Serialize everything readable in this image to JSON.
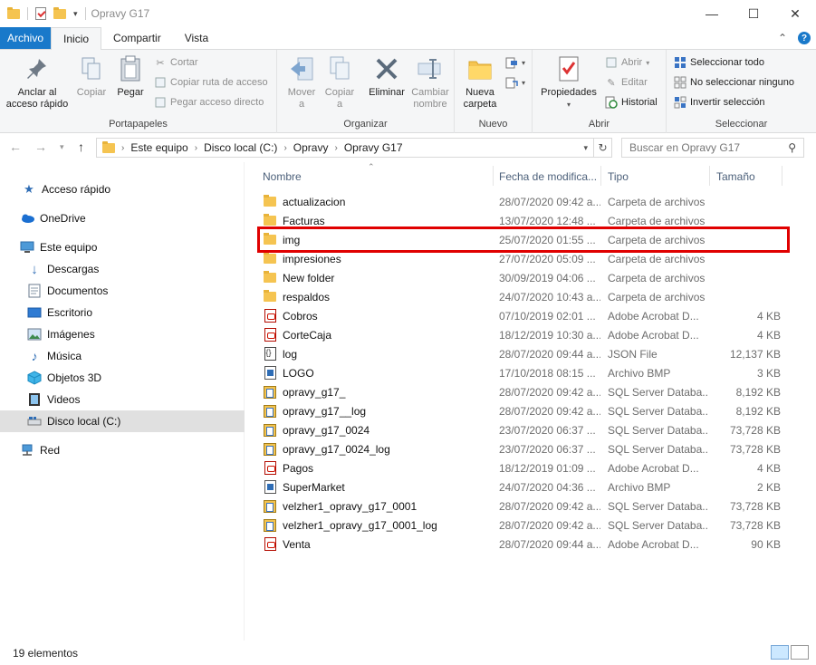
{
  "window": {
    "title": "Opravy G17",
    "minimize": "—",
    "maximize": "☐",
    "close": "✕"
  },
  "tabs": [
    {
      "label": "Archivo"
    },
    {
      "label": "Inicio"
    },
    {
      "label": "Compartir"
    },
    {
      "label": "Vista"
    }
  ],
  "ribbon": {
    "portapapeles": {
      "label": "Portapapeles",
      "pin": "Anclar al\nacceso rápido",
      "copy": "Copiar",
      "paste": "Pegar",
      "cut": "Cortar",
      "copy_path": "Copiar ruta de acceso",
      "paste_shortcut": "Pegar acceso directo"
    },
    "organizar": {
      "label": "Organizar",
      "move": "Mover\na",
      "copy_to": "Copiar\na",
      "delete": "Eliminar",
      "rename": "Cambiar\nnombre"
    },
    "nuevo": {
      "label": "Nuevo",
      "new_folder": "Nueva\ncarpeta"
    },
    "abrir": {
      "label": "Abrir",
      "properties": "Propiedades",
      "open": "Abrir",
      "edit": "Editar",
      "history": "Historial"
    },
    "seleccionar": {
      "label": "Seleccionar",
      "select_all": "Seleccionar todo",
      "select_none": "No seleccionar ninguno",
      "invert": "Invertir selección"
    }
  },
  "address": {
    "crumbs": [
      "Este equipo",
      "Disco local (C:)",
      "Opravy",
      "Opravy G17"
    ],
    "search_placeholder": "Buscar en Opravy G17"
  },
  "nav": [
    {
      "label": "Acceso rápido",
      "icon": "star-icon"
    },
    {
      "label": "OneDrive",
      "icon": "cloud-icon"
    },
    {
      "label": "Este equipo",
      "icon": "computer-icon"
    },
    {
      "label": "Descargas",
      "icon": "download-icon"
    },
    {
      "label": "Documentos",
      "icon": "document-icon"
    },
    {
      "label": "Escritorio",
      "icon": "desktop-icon"
    },
    {
      "label": "Imágenes",
      "icon": "pictures-icon"
    },
    {
      "label": "Música",
      "icon": "music-icon"
    },
    {
      "label": "Objetos 3D",
      "icon": "cube-icon"
    },
    {
      "label": "Videos",
      "icon": "video-icon"
    },
    {
      "label": "Disco local (C:)",
      "icon": "drive-icon"
    },
    {
      "label": "Red",
      "icon": "network-icon"
    }
  ],
  "columns": {
    "name": "Nombre",
    "date": "Fecha de modifica...",
    "type": "Tipo",
    "size": "Tamaño"
  },
  "files": [
    {
      "name": "actualizacion",
      "date": "28/07/2020 09:42 a...",
      "type": "Carpeta de archivos",
      "size": "",
      "icon": "folder"
    },
    {
      "name": "Facturas",
      "date": "13/07/2020 12:48 ...",
      "type": "Carpeta de archivos",
      "size": "",
      "icon": "folder"
    },
    {
      "name": "img",
      "date": "25/07/2020 01:55 ...",
      "type": "Carpeta de archivos",
      "size": "",
      "icon": "folder"
    },
    {
      "name": "impresiones",
      "date": "27/07/2020 05:09 ...",
      "type": "Carpeta de archivos",
      "size": "",
      "icon": "folder"
    },
    {
      "name": "New folder",
      "date": "30/09/2019 04:06 ...",
      "type": "Carpeta de archivos",
      "size": "",
      "icon": "folder"
    },
    {
      "name": "respaldos",
      "date": "24/07/2020 10:43 a...",
      "type": "Carpeta de archivos",
      "size": "",
      "icon": "folder"
    },
    {
      "name": "Cobros",
      "date": "07/10/2019 02:01 ...",
      "type": "Adobe Acrobat D...",
      "size": "4 KB",
      "icon": "pdf"
    },
    {
      "name": "CorteCaja",
      "date": "18/12/2019 10:30 a...",
      "type": "Adobe Acrobat D...",
      "size": "4 KB",
      "icon": "pdf"
    },
    {
      "name": "log",
      "date": "28/07/2020 09:44 a...",
      "type": "JSON File",
      "size": "12,137 KB",
      "icon": "json"
    },
    {
      "name": "LOGO",
      "date": "17/10/2018 08:15 ...",
      "type": "Archivo BMP",
      "size": "3 KB",
      "icon": "bmp"
    },
    {
      "name": "opravy_g17_",
      "date": "28/07/2020 09:42 a...",
      "type": "SQL Server Databa...",
      "size": "8,192 KB",
      "icon": "db"
    },
    {
      "name": "opravy_g17__log",
      "date": "28/07/2020 09:42 a...",
      "type": "SQL Server Databa...",
      "size": "8,192 KB",
      "icon": "db"
    },
    {
      "name": "opravy_g17_0024",
      "date": "23/07/2020 06:37 ...",
      "type": "SQL Server Databa...",
      "size": "73,728 KB",
      "icon": "db"
    },
    {
      "name": "opravy_g17_0024_log",
      "date": "23/07/2020 06:37 ...",
      "type": "SQL Server Databa...",
      "size": "73,728 KB",
      "icon": "db"
    },
    {
      "name": "Pagos",
      "date": "18/12/2019 01:09 ...",
      "type": "Adobe Acrobat D...",
      "size": "4 KB",
      "icon": "pdf"
    },
    {
      "name": "SuperMarket",
      "date": "24/07/2020 04:36 ...",
      "type": "Archivo BMP",
      "size": "2 KB",
      "icon": "bmp"
    },
    {
      "name": "velzher1_opravy_g17_0001",
      "date": "28/07/2020 09:42 a...",
      "type": "SQL Server Databa...",
      "size": "73,728 KB",
      "icon": "db"
    },
    {
      "name": "velzher1_opravy_g17_0001_log",
      "date": "28/07/2020 09:42 a...",
      "type": "SQL Server Databa...",
      "size": "73,728 KB",
      "icon": "db"
    },
    {
      "name": "Venta",
      "date": "28/07/2020 09:44 a...",
      "type": "Adobe Acrobat D...",
      "size": "90 KB",
      "icon": "pdf"
    }
  ],
  "status": {
    "count": "19 elementos"
  },
  "colors": {
    "accent": "#1979ca",
    "highlight": "#e00000"
  }
}
